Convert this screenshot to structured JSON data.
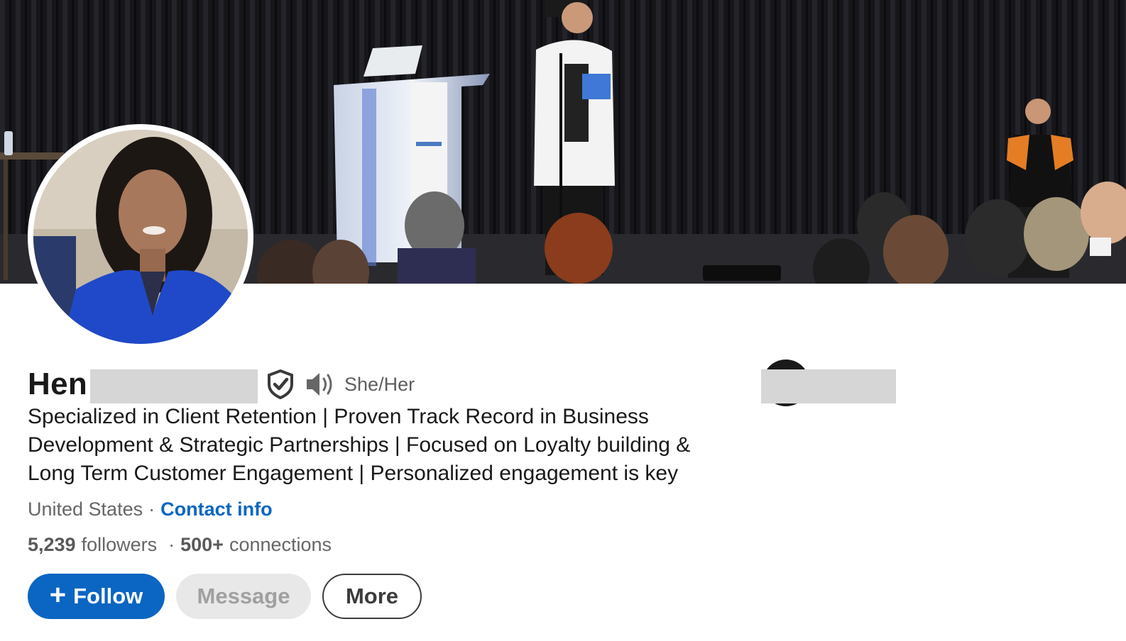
{
  "profile": {
    "name_visible": "Hen",
    "pronouns": "She/Her",
    "headline": "Specialized in Client Retention | Proven Track Record in Business Development & Strategic Partnerships | Focused on Loyalty building & Long Term Customer Engagement | Personalized engagement is key",
    "location": "United States",
    "location_separator": "·",
    "contact_info_label": "Contact info",
    "followers_count": "5,239",
    "followers_label": "followers",
    "stats_separator": "·",
    "connections_count": "500+",
    "connections_label": "connections"
  },
  "actions": {
    "follow_icon": "+",
    "follow_label": "Follow",
    "message_label": "Message",
    "more_label": "More"
  },
  "icons": {
    "verified": "shield-check-icon",
    "pronunciation": "speaker-icon",
    "company": "star-icon"
  },
  "colors": {
    "accent": "#0a66c2",
    "text_primary": "#191919",
    "text_secondary": "#666666",
    "redaction": "#d6d6d6"
  }
}
